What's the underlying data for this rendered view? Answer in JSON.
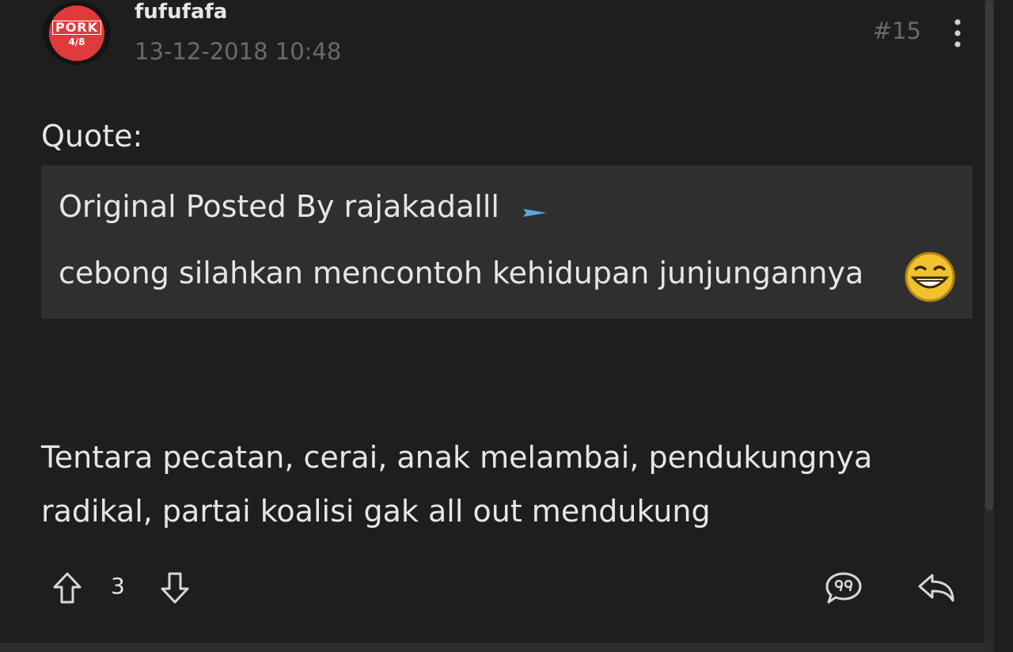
{
  "post": {
    "avatar": {
      "logo_text": "PORK",
      "sub_text": "4/8"
    },
    "username": "fufufafa",
    "timestamp": "13-12-2018 10:48",
    "post_number": "#15"
  },
  "quote": {
    "label": "Quote:",
    "author_line": "Original Posted By rajakadalll",
    "text": "cebong silahkan mencontoh kehidupan junjungannya"
  },
  "body": {
    "text": "Tentara pecatan, cerai, anak melambai, pendukungnya radikal, partai koalisi gak all out mendukung"
  },
  "actions": {
    "vote_count": "3"
  },
  "icons": {
    "more": "more-vertical-icon",
    "arrow": "arrow-right-icon",
    "emoji": "laughing-emoji-icon",
    "upvote": "arrow-up-icon",
    "downvote": "arrow-down-icon",
    "quote_reply": "quote-bubble-icon",
    "reply": "reply-icon"
  },
  "colors": {
    "background": "#1e1e1e",
    "quote_background": "#2f2f2f",
    "muted_text": "#6a6a6a",
    "text": "#e6e6e6",
    "accent_blue": "#5ba7e0",
    "avatar_red": "#e23a3a"
  }
}
